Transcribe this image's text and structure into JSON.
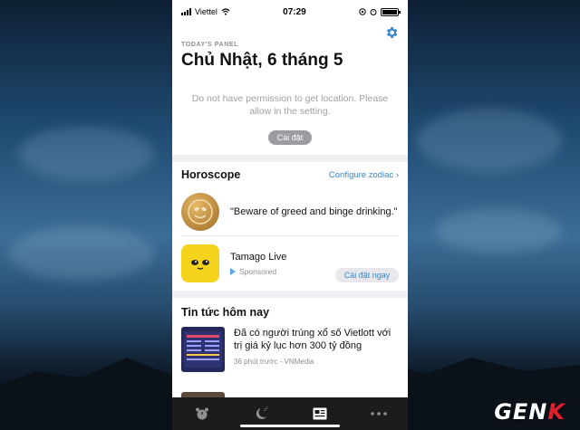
{
  "status_bar": {
    "carrier": "Viettel",
    "time": "07:29"
  },
  "today_panel": {
    "label": "TODAY'S PANEL",
    "date": "Chủ Nhật, 6 tháng 5",
    "permission_message": "Do not have permission to get location. Please allow in the setting.",
    "settings_button": "Cài đặt"
  },
  "horoscope": {
    "title": "Horoscope",
    "configure_link": "Configure zodiac ›",
    "quote": "\"Beware of greed and binge drinking.\""
  },
  "ad": {
    "app_name": "Tamago Live",
    "sponsored_label": "Sponsored",
    "install_button": "Cài đặt ngay"
  },
  "news": {
    "title": "Tin tức hôm nay",
    "items": [
      {
        "headline": "Đã có người trúng xổ số Vietlott với trị giá kỷ lục hơn 300 tỷ đồng",
        "meta": "36 phút trước - VNMedia"
      }
    ]
  },
  "tabs": [
    {
      "icon": "alarm-clock-icon"
    },
    {
      "icon": "sleep-moon-icon"
    },
    {
      "icon": "news-panel-icon"
    },
    {
      "icon": "more-dots-icon"
    }
  ],
  "watermark": {
    "main": "GEN",
    "accent": "K"
  },
  "colors": {
    "accent": "#3a87c9",
    "tab_bar": "#1c1c1e",
    "button_gray": "#9c9ca0"
  }
}
